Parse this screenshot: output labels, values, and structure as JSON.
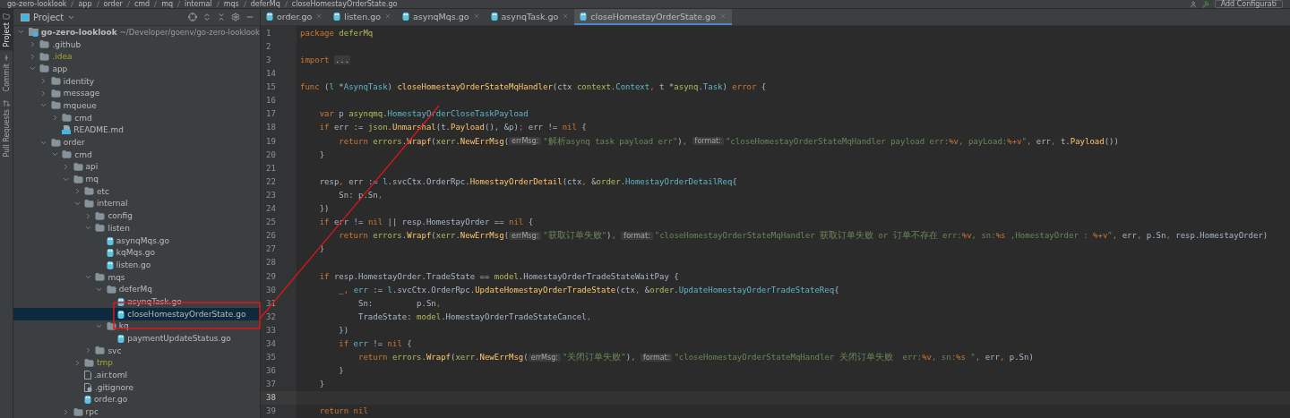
{
  "breadcrumbs": [
    "go-zero-looklook",
    "app",
    "order",
    "cmd",
    "mq",
    "internal",
    "mqs",
    "deferMq",
    "closeHomestayOrderState.go"
  ],
  "toolbar": {
    "run_config": "Add Configurati"
  },
  "tool_strip": [
    {
      "label": "Project",
      "selected": true
    },
    {
      "label": "Commit",
      "selected": false
    },
    {
      "label": "Pull Requests",
      "selected": false
    }
  ],
  "project_panel": {
    "title": "Project"
  },
  "tree": [
    {
      "name": "go-zero-looklook",
      "kind": "module",
      "hint": "~/Developer/goenv/go-zero-looklook",
      "expanded": true,
      "selected": false,
      "ignored": false,
      "children": [
        {
          "name": ".github",
          "kind": "folder",
          "expanded": false,
          "selected": false,
          "ignored": false
        },
        {
          "name": ".idea",
          "kind": "folder",
          "expanded": false,
          "selected": false,
          "ignored": true
        },
        {
          "name": "app",
          "kind": "folder",
          "expanded": true,
          "selected": false,
          "ignored": false,
          "children": [
            {
              "name": "identity",
              "kind": "folder",
              "expanded": false,
              "selected": false,
              "ignored": false
            },
            {
              "name": "message",
              "kind": "folder",
              "expanded": false,
              "selected": false,
              "ignored": false
            },
            {
              "name": "mqueue",
              "kind": "folder",
              "expanded": true,
              "selected": false,
              "ignored": false,
              "children": [
                {
                  "name": "cmd",
                  "kind": "folder",
                  "expanded": false,
                  "selected": false,
                  "ignored": false
                },
                {
                  "name": "README.md",
                  "kind": "md",
                  "selected": false,
                  "ignored": false
                }
              ]
            },
            {
              "name": "order",
              "kind": "folder",
              "expanded": true,
              "selected": false,
              "ignored": false,
              "children": [
                {
                  "name": "cmd",
                  "kind": "folder",
                  "expanded": true,
                  "selected": false,
                  "ignored": false,
                  "children": [
                    {
                      "name": "api",
                      "kind": "folder",
                      "expanded": false,
                      "selected": false,
                      "ignored": false
                    },
                    {
                      "name": "mq",
                      "kind": "folder",
                      "expanded": true,
                      "selected": false,
                      "ignored": false,
                      "children": [
                        {
                          "name": "etc",
                          "kind": "folder",
                          "expanded": false,
                          "selected": false,
                          "ignored": false
                        },
                        {
                          "name": "internal",
                          "kind": "folder",
                          "expanded": true,
                          "selected": false,
                          "ignored": false,
                          "children": [
                            {
                              "name": "config",
                              "kind": "folder",
                              "expanded": false,
                              "selected": false,
                              "ignored": false
                            },
                            {
                              "name": "listen",
                              "kind": "folder",
                              "expanded": true,
                              "selected": false,
                              "ignored": false,
                              "children": [
                                {
                                  "name": "asynqMqs.go",
                                  "kind": "go",
                                  "selected": false,
                                  "ignored": false
                                },
                                {
                                  "name": "kqMqs.go",
                                  "kind": "go",
                                  "selected": false,
                                  "ignored": false
                                },
                                {
                                  "name": "listen.go",
                                  "kind": "go",
                                  "selected": false,
                                  "ignored": false
                                }
                              ]
                            },
                            {
                              "name": "mqs",
                              "kind": "folder",
                              "expanded": true,
                              "selected": false,
                              "ignored": false,
                              "children": [
                                {
                                  "name": "deferMq",
                                  "kind": "folder",
                                  "expanded": true,
                                  "selected": false,
                                  "ignored": false,
                                  "children": [
                                    {
                                      "name": "asynqTask.go",
                                      "kind": "go",
                                      "selected": false,
                                      "ignored": false
                                    },
                                    {
                                      "name": "closeHomestayOrderState.go",
                                      "kind": "go",
                                      "selected": true,
                                      "ignored": false
                                    }
                                  ]
                                },
                                {
                                  "name": "kq",
                                  "kind": "folder",
                                  "expanded": true,
                                  "selected": false,
                                  "ignored": false,
                                  "children": [
                                    {
                                      "name": "paymentUpdateStatus.go",
                                      "kind": "go",
                                      "selected": false,
                                      "ignored": false
                                    }
                                  ]
                                }
                              ]
                            },
                            {
                              "name": "svc",
                              "kind": "folder",
                              "expanded": false,
                              "selected": false,
                              "ignored": false
                            }
                          ]
                        },
                        {
                          "name": "tmp",
                          "kind": "folder",
                          "expanded": false,
                          "selected": false,
                          "ignored": true
                        },
                        {
                          "name": ".air.toml",
                          "kind": "text",
                          "selected": false,
                          "ignored": false
                        },
                        {
                          "name": ".gitignore",
                          "kind": "ignore",
                          "selected": false,
                          "ignored": false
                        },
                        {
                          "name": "order.go",
                          "kind": "go",
                          "selected": false,
                          "ignored": false
                        }
                      ]
                    },
                    {
                      "name": "rpc",
                      "kind": "folder",
                      "expanded": false,
                      "selected": false,
                      "ignored": false
                    }
                  ]
                }
              ]
            }
          ]
        }
      ]
    }
  ],
  "tabs": [
    {
      "label": "order.go",
      "selected": false
    },
    {
      "label": "listen.go",
      "selected": false
    },
    {
      "label": "asynqMqs.go",
      "selected": false
    },
    {
      "label": "asynqTask.go",
      "selected": false
    },
    {
      "label": "closeHomestayOrderState.go",
      "selected": true
    }
  ],
  "code": [
    {
      "num": "1",
      "current": false,
      "tokens": [
        {
          "kind": "kw",
          "t": "package "
        },
        {
          "kind": "pkg",
          "t": "deferMq"
        }
      ]
    },
    {
      "num": "2",
      "current": false
    },
    {
      "num": "3",
      "current": false,
      "tokens": [
        {
          "kind": "kw",
          "t": "import "
        },
        {
          "kind": "fold",
          "t": "..."
        }
      ]
    },
    {
      "num": "14",
      "current": false
    },
    {
      "num": "15",
      "current": false,
      "tokens": [
        {
          "kind": "kw",
          "t": "func "
        },
        {
          "kind": "plain",
          "t": "("
        },
        {
          "kind": "var",
          "t": "l"
        },
        {
          "kind": "plain",
          "t": " *"
        },
        {
          "kind": "type",
          "t": "AsynqTask"
        },
        {
          "kind": "plain",
          "t": ") "
        },
        {
          "kind": "fn",
          "t": "closeHomestayOrderStateMqHandler"
        },
        {
          "kind": "plain",
          "t": "(ctx "
        },
        {
          "kind": "pkg",
          "t": "context"
        },
        {
          "kind": "plain",
          "t": "."
        },
        {
          "kind": "type",
          "t": "Context"
        },
        {
          "kind": "kw",
          "t": ", "
        },
        {
          "kind": "plain",
          "t": "t *"
        },
        {
          "kind": "pkg",
          "t": "asynq"
        },
        {
          "kind": "plain",
          "t": "."
        },
        {
          "kind": "type",
          "t": "Task"
        },
        {
          "kind": "plain",
          "t": ") "
        },
        {
          "kind": "kw",
          "t": "error"
        },
        {
          "kind": "plain",
          "t": " {"
        }
      ]
    },
    {
      "num": "16",
      "current": false
    },
    {
      "num": "17",
      "current": false,
      "tokens": [
        {
          "kind": "kw",
          "t": "    var "
        },
        {
          "kind": "plain",
          "t": "p "
        },
        {
          "kind": "pkg",
          "t": "asynqmq"
        },
        {
          "kind": "plain",
          "t": "."
        },
        {
          "kind": "type",
          "t": "HomestayOrderCloseTaskPayload"
        }
      ]
    },
    {
      "num": "18",
      "current": false,
      "tokens": [
        {
          "kind": "kw",
          "t": "    if "
        },
        {
          "kind": "plain",
          "t": "err := "
        },
        {
          "kind": "pkg",
          "t": "json"
        },
        {
          "kind": "plain",
          "t": "."
        },
        {
          "kind": "fn",
          "t": "Unmarshal"
        },
        {
          "kind": "plain",
          "t": "(t."
        },
        {
          "kind": "fn",
          "t": "Payload"
        },
        {
          "kind": "plain",
          "t": "(), &p)"
        },
        {
          "kind": "kw",
          "t": "; "
        },
        {
          "kind": "plain",
          "t": "err != "
        },
        {
          "kind": "kw",
          "t": "nil"
        },
        {
          "kind": "plain",
          "t": " {"
        }
      ]
    },
    {
      "num": "19",
      "current": false,
      "tokens": [
        {
          "kind": "kw",
          "t": "        return "
        },
        {
          "kind": "pkg",
          "t": "errors"
        },
        {
          "kind": "plain",
          "t": "."
        },
        {
          "kind": "fn",
          "t": "Wrapf"
        },
        {
          "kind": "plain",
          "t": "("
        },
        {
          "kind": "pkg",
          "t": "xerr"
        },
        {
          "kind": "plain",
          "t": "."
        },
        {
          "kind": "fn",
          "t": "NewErrMsg"
        },
        {
          "kind": "plain",
          "t": "("
        },
        {
          "kind": "hint",
          "t": "errMsg:"
        },
        {
          "kind": "str",
          "t": "\"解析asynq task payload err\""
        },
        {
          "kind": "plain",
          "t": ")"
        },
        {
          "kind": "kw",
          "t": ", "
        },
        {
          "kind": "hint",
          "t": "format:"
        },
        {
          "kind": "str",
          "t": "\"closeHomestayOrderStateMqHandler payload err:"
        },
        {
          "kind": "fmt",
          "t": "%v"
        },
        {
          "kind": "str",
          "t": ", payLoad:"
        },
        {
          "kind": "fmt",
          "t": "%+v"
        },
        {
          "kind": "str",
          "t": "\""
        },
        {
          "kind": "kw",
          "t": ", "
        },
        {
          "kind": "plain",
          "t": "err"
        },
        {
          "kind": "kw",
          "t": ", "
        },
        {
          "kind": "plain",
          "t": "t."
        },
        {
          "kind": "fn",
          "t": "Payload"
        },
        {
          "kind": "plain",
          "t": "())"
        }
      ]
    },
    {
      "num": "20",
      "current": false,
      "tokens": [
        {
          "kind": "plain",
          "t": "    }"
        }
      ]
    },
    {
      "num": "21",
      "current": false
    },
    {
      "num": "22",
      "current": false,
      "tokens": [
        {
          "kind": "plain",
          "t": "    resp"
        },
        {
          "kind": "kw",
          "t": ", "
        },
        {
          "kind": "plain",
          "t": "err := "
        },
        {
          "kind": "var",
          "t": "l"
        },
        {
          "kind": "plain",
          "t": ".svcCtx.OrderRpc."
        },
        {
          "kind": "fn",
          "t": "HomestayOrderDetail"
        },
        {
          "kind": "plain",
          "t": "(ctx"
        },
        {
          "kind": "kw",
          "t": ", "
        },
        {
          "kind": "plain",
          "t": "&"
        },
        {
          "kind": "pkg",
          "t": "order"
        },
        {
          "kind": "plain",
          "t": "."
        },
        {
          "kind": "type",
          "t": "HomestayOrderDetailReq"
        },
        {
          "kind": "plain",
          "t": "{"
        }
      ]
    },
    {
      "num": "23",
      "current": false,
      "tokens": [
        {
          "kind": "plain",
          "t": "        Sn: p.Sn"
        },
        {
          "kind": "kw",
          "t": ","
        }
      ]
    },
    {
      "num": "24",
      "current": false,
      "tokens": [
        {
          "kind": "plain",
          "t": "    })"
        }
      ]
    },
    {
      "num": "25",
      "current": false,
      "tokens": [
        {
          "kind": "kw",
          "t": "    if "
        },
        {
          "kind": "plain",
          "t": "err != "
        },
        {
          "kind": "kw",
          "t": "nil"
        },
        {
          "kind": "plain",
          "t": " || resp.HomestayOrder == "
        },
        {
          "kind": "kw",
          "t": "nil"
        },
        {
          "kind": "plain",
          "t": " {"
        }
      ]
    },
    {
      "num": "26",
      "current": false,
      "tokens": [
        {
          "kind": "kw",
          "t": "        return "
        },
        {
          "kind": "pkg",
          "t": "errors"
        },
        {
          "kind": "plain",
          "t": "."
        },
        {
          "kind": "fn",
          "t": "Wrapf"
        },
        {
          "kind": "plain",
          "t": "("
        },
        {
          "kind": "pkg",
          "t": "xerr"
        },
        {
          "kind": "plain",
          "t": "."
        },
        {
          "kind": "fn",
          "t": "NewErrMsg"
        },
        {
          "kind": "plain",
          "t": "("
        },
        {
          "kind": "hint",
          "t": "errMsg:"
        },
        {
          "kind": "str",
          "t": "\"获取订单失败\""
        },
        {
          "kind": "plain",
          "t": ")"
        },
        {
          "kind": "kw",
          "t": ", "
        },
        {
          "kind": "hint",
          "t": "format:"
        },
        {
          "kind": "str",
          "t": "\"closeHomestayOrderStateMqHandler 获取订单失败 or 订单不存在 err:"
        },
        {
          "kind": "fmt",
          "t": "%v"
        },
        {
          "kind": "str",
          "t": ", sn:"
        },
        {
          "kind": "fmt",
          "t": "%s"
        },
        {
          "kind": "str",
          "t": " ,HomestayOrder : "
        },
        {
          "kind": "fmt",
          "t": "%+v"
        },
        {
          "kind": "str",
          "t": "\""
        },
        {
          "kind": "kw",
          "t": ", "
        },
        {
          "kind": "plain",
          "t": "err"
        },
        {
          "kind": "kw",
          "t": ", "
        },
        {
          "kind": "plain",
          "t": "p.Sn"
        },
        {
          "kind": "kw",
          "t": ", "
        },
        {
          "kind": "plain",
          "t": "resp.HomestayOrder)"
        }
      ]
    },
    {
      "num": "27",
      "current": false,
      "tokens": [
        {
          "kind": "plain",
          "t": "    }"
        }
      ]
    },
    {
      "num": "28",
      "current": false
    },
    {
      "num": "29",
      "current": false,
      "tokens": [
        {
          "kind": "kw",
          "t": "    if "
        },
        {
          "kind": "plain",
          "t": "resp.HomestayOrder.TradeState == "
        },
        {
          "kind": "pkg",
          "t": "model"
        },
        {
          "kind": "plain",
          "t": ".HomestayOrderTradeStateWaitPay {"
        }
      ]
    },
    {
      "num": "30",
      "current": false,
      "tokens": [
        {
          "kind": "plain",
          "t": "        _"
        },
        {
          "kind": "kw",
          "t": ", "
        },
        {
          "kind": "var",
          "t": "err"
        },
        {
          "kind": "plain",
          "t": " := "
        },
        {
          "kind": "var",
          "t": "l"
        },
        {
          "kind": "plain",
          "t": ".svcCtx.OrderRpc."
        },
        {
          "kind": "fn",
          "t": "UpdateHomestayOrderTradeState"
        },
        {
          "kind": "plain",
          "t": "(ctx"
        },
        {
          "kind": "kw",
          "t": ", "
        },
        {
          "kind": "plain",
          "t": "&"
        },
        {
          "kind": "pkg",
          "t": "order"
        },
        {
          "kind": "plain",
          "t": "."
        },
        {
          "kind": "type",
          "t": "UpdateHomestayOrderTradeStateReq"
        },
        {
          "kind": "plain",
          "t": "{"
        }
      ]
    },
    {
      "num": "31",
      "current": false,
      "tokens": [
        {
          "kind": "plain",
          "t": "            Sn:         p.Sn"
        },
        {
          "kind": "kw",
          "t": ","
        }
      ]
    },
    {
      "num": "32",
      "current": false,
      "tokens": [
        {
          "kind": "plain",
          "t": "            TradeState: "
        },
        {
          "kind": "pkg",
          "t": "model"
        },
        {
          "kind": "plain",
          "t": ".HomestayOrderTradeStateCancel"
        },
        {
          "kind": "kw",
          "t": ","
        }
      ]
    },
    {
      "num": "33",
      "current": false,
      "tokens": [
        {
          "kind": "plain",
          "t": "        })"
        }
      ]
    },
    {
      "num": "34",
      "current": false,
      "tokens": [
        {
          "kind": "kw",
          "t": "        if "
        },
        {
          "kind": "var",
          "t": "err"
        },
        {
          "kind": "plain",
          "t": " != "
        },
        {
          "kind": "kw",
          "t": "nil"
        },
        {
          "kind": "plain",
          "t": " {"
        }
      ]
    },
    {
      "num": "35",
      "current": false,
      "tokens": [
        {
          "kind": "kw",
          "t": "            return "
        },
        {
          "kind": "pkg",
          "t": "errors"
        },
        {
          "kind": "plain",
          "t": "."
        },
        {
          "kind": "fn",
          "t": "Wrapf"
        },
        {
          "kind": "plain",
          "t": "("
        },
        {
          "kind": "pkg",
          "t": "xerr"
        },
        {
          "kind": "plain",
          "t": "."
        },
        {
          "kind": "fn",
          "t": "NewErrMsg"
        },
        {
          "kind": "plain",
          "t": "("
        },
        {
          "kind": "hint",
          "t": "errMsg:"
        },
        {
          "kind": "str",
          "t": "\"关闭订单失败\""
        },
        {
          "kind": "plain",
          "t": ")"
        },
        {
          "kind": "kw",
          "t": ", "
        },
        {
          "kind": "hint",
          "t": "format:"
        },
        {
          "kind": "str",
          "t": "\"closeHomestayOrderStateMqHandler 关闭订单失败  err:"
        },
        {
          "kind": "fmt",
          "t": "%v"
        },
        {
          "kind": "str",
          "t": ", sn:"
        },
        {
          "kind": "fmt",
          "t": "%s"
        },
        {
          "kind": "str",
          "t": " \""
        },
        {
          "kind": "kw",
          "t": ", "
        },
        {
          "kind": "plain",
          "t": "err"
        },
        {
          "kind": "kw",
          "t": ", "
        },
        {
          "kind": "plain",
          "t": "p.Sn)"
        }
      ]
    },
    {
      "num": "36",
      "current": false,
      "tokens": [
        {
          "kind": "plain",
          "t": "        }"
        }
      ]
    },
    {
      "num": "37",
      "current": false,
      "tokens": [
        {
          "kind": "plain",
          "t": "    }"
        }
      ]
    },
    {
      "num": "38",
      "current": true
    },
    {
      "num": "39",
      "current": false,
      "tokens": [
        {
          "kind": "kw",
          "t": "    return "
        },
        {
          "kind": "kw",
          "t": "nil"
        }
      ]
    }
  ]
}
